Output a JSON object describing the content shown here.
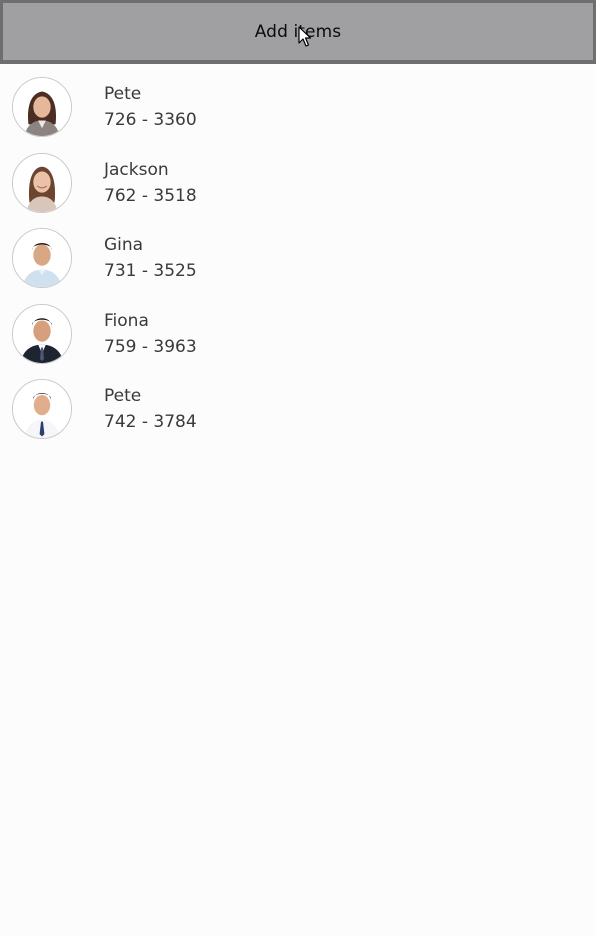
{
  "toolbar": {
    "add_label": "Add items"
  },
  "contacts": [
    {
      "name": "Pete",
      "phone": "726 - 3360",
      "avatar": "woman-long-hair-icon"
    },
    {
      "name": "Jackson",
      "phone": "762 - 3518",
      "avatar": "woman-smiling-icon"
    },
    {
      "name": "Gina",
      "phone": "731 - 3525",
      "avatar": "man-light-shirt-icon"
    },
    {
      "name": "Fiona",
      "phone": "759 - 3963",
      "avatar": "man-dark-suit-icon"
    },
    {
      "name": "Pete",
      "phone": "742 - 3784",
      "avatar": "man-tie-icon"
    }
  ],
  "colors": {
    "button_bg": "#a09fa1",
    "button_border": "#6e6e70",
    "page_bg": "#fcfcfd",
    "text": "#3a3a3c"
  }
}
